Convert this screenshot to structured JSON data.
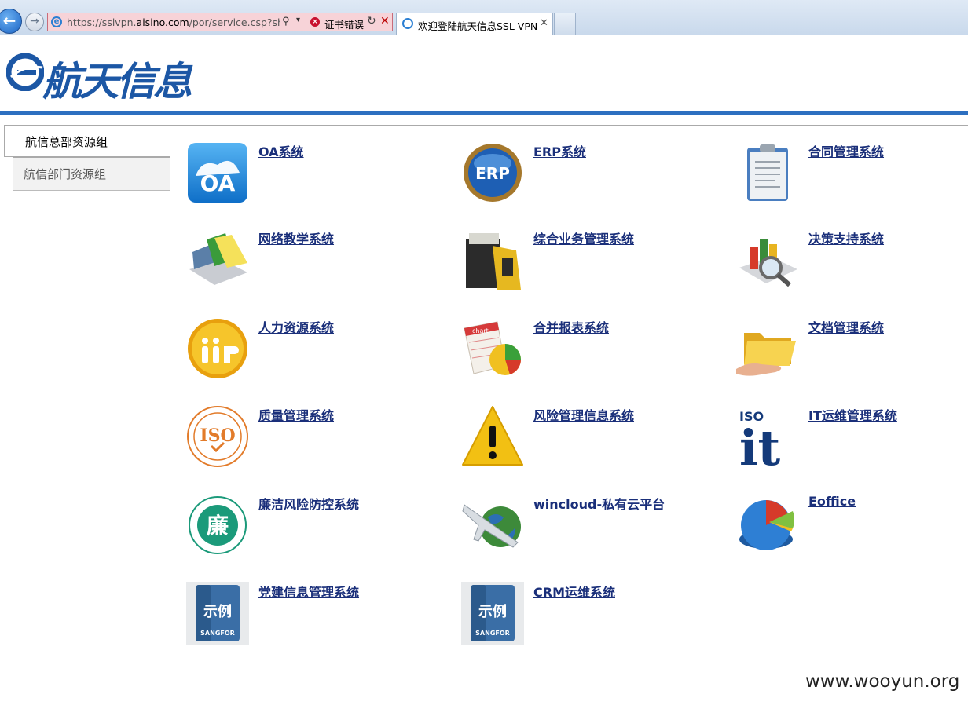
{
  "browser": {
    "url_prefix": "https://sslvpn.",
    "url_domain": "aisino.com",
    "url_path": "/por/service.csp?shov",
    "cert_error": "证书错误",
    "tab_title": "欢迎登陆航天信息SSL VPN"
  },
  "header": {
    "logo_text": "航天信息"
  },
  "sidebar": {
    "items": [
      {
        "label": "航信总部资源组",
        "active": true
      },
      {
        "label": "航信部门资源组",
        "active": false
      }
    ]
  },
  "apps": [
    {
      "label": "OA系统",
      "icon": "oa-icon"
    },
    {
      "label": "ERP系统",
      "icon": "erp-icon"
    },
    {
      "label": "合同管理系统",
      "icon": "contract-clipboard-icon"
    },
    {
      "label": "网络教学系统",
      "icon": "laptop-notes-icon"
    },
    {
      "label": "综合业务管理系统",
      "icon": "business-box-icon"
    },
    {
      "label": "决策支持系统",
      "icon": "chart-magnifier-icon"
    },
    {
      "label": "人力资源系统",
      "icon": "people-badge-icon"
    },
    {
      "label": "合并报表系统",
      "icon": "report-chart-icon"
    },
    {
      "label": "文档管理系统",
      "icon": "folder-hand-icon"
    },
    {
      "label": "质量管理系统",
      "icon": "iso-seal-icon"
    },
    {
      "label": "风险管理信息系统",
      "icon": "warning-icon"
    },
    {
      "label": "IT运维管理系统",
      "icon": "iso-it-icon"
    },
    {
      "label": "廉洁风险防控系统",
      "icon": "lian-seal-icon"
    },
    {
      "label": "wincloud-私有云平台",
      "icon": "airplane-globe-icon"
    },
    {
      "label": "Eoffice",
      "icon": "pie-chart-icon"
    },
    {
      "label": "党建信息管理系统",
      "icon": "sangfor-sample-icon",
      "icon_text": "示例",
      "icon_brand": "SANGFOR"
    },
    {
      "label": "CRM运维系统",
      "icon": "sangfor-sample-icon",
      "icon_text": "示例",
      "icon_brand": "SANGFOR"
    }
  ],
  "icon_texts": {
    "oa": "OA",
    "erp": "ERP",
    "iso": "ISO",
    "it": "it",
    "lian": "廉",
    "chart": "chart"
  },
  "watermark": "www.wooyun.org"
}
